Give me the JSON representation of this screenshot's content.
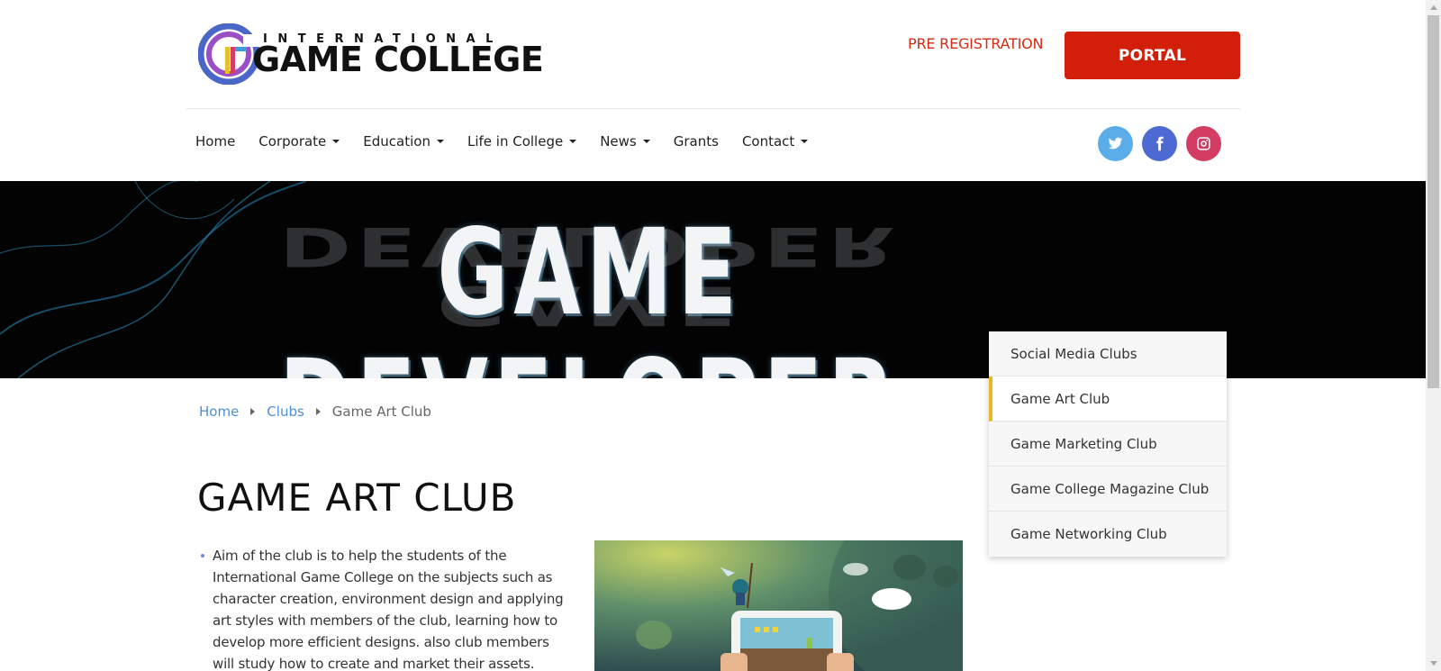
{
  "header": {
    "logo_top": "INTERNATIONAL",
    "logo_main": "GAME COLLEGE",
    "pre_registration": "PRE REGISTRATION",
    "portal": "PORTAL"
  },
  "nav": {
    "items": [
      {
        "label": "Home",
        "has_dropdown": false
      },
      {
        "label": "Corporate",
        "has_dropdown": true
      },
      {
        "label": "Education",
        "has_dropdown": true
      },
      {
        "label": "Life in College",
        "has_dropdown": true
      },
      {
        "label": "News",
        "has_dropdown": true
      },
      {
        "label": "Grants",
        "has_dropdown": false
      },
      {
        "label": "Contact",
        "has_dropdown": true
      }
    ]
  },
  "social": {
    "icons": [
      "twitter-icon",
      "facebook-icon",
      "instagram-icon"
    ],
    "colors": {
      "twitter": "#5aade9",
      "facebook": "#4d6ad2",
      "instagram": "#d43d63"
    }
  },
  "banner": {
    "title": "GAME DEVELOPER"
  },
  "breadcrumb": {
    "items": [
      "Home",
      "Clubs",
      "Game Art Club"
    ]
  },
  "page": {
    "title": "GAME ART CLUB",
    "bullets": [
      "Aim of the club is to help the students of the International Game College on the subjects such as character creation, environment design and applying art styles with members of the club, learning how to develop more efficient designs. also club members will study how to create and market their assets."
    ]
  },
  "dropdown": {
    "items": [
      {
        "label": "Social Media Clubs",
        "active": false
      },
      {
        "label": "Game Art Club",
        "active": true
      },
      {
        "label": "Game Marketing Club",
        "active": false
      },
      {
        "label": "Game College Magazine Club",
        "active": false
      },
      {
        "label": "Game Networking Club",
        "active": false
      }
    ]
  },
  "colors": {
    "accent_red": "#d11f0a",
    "link_blue": "#4f8ed6",
    "active_marker": "#e9b925"
  }
}
